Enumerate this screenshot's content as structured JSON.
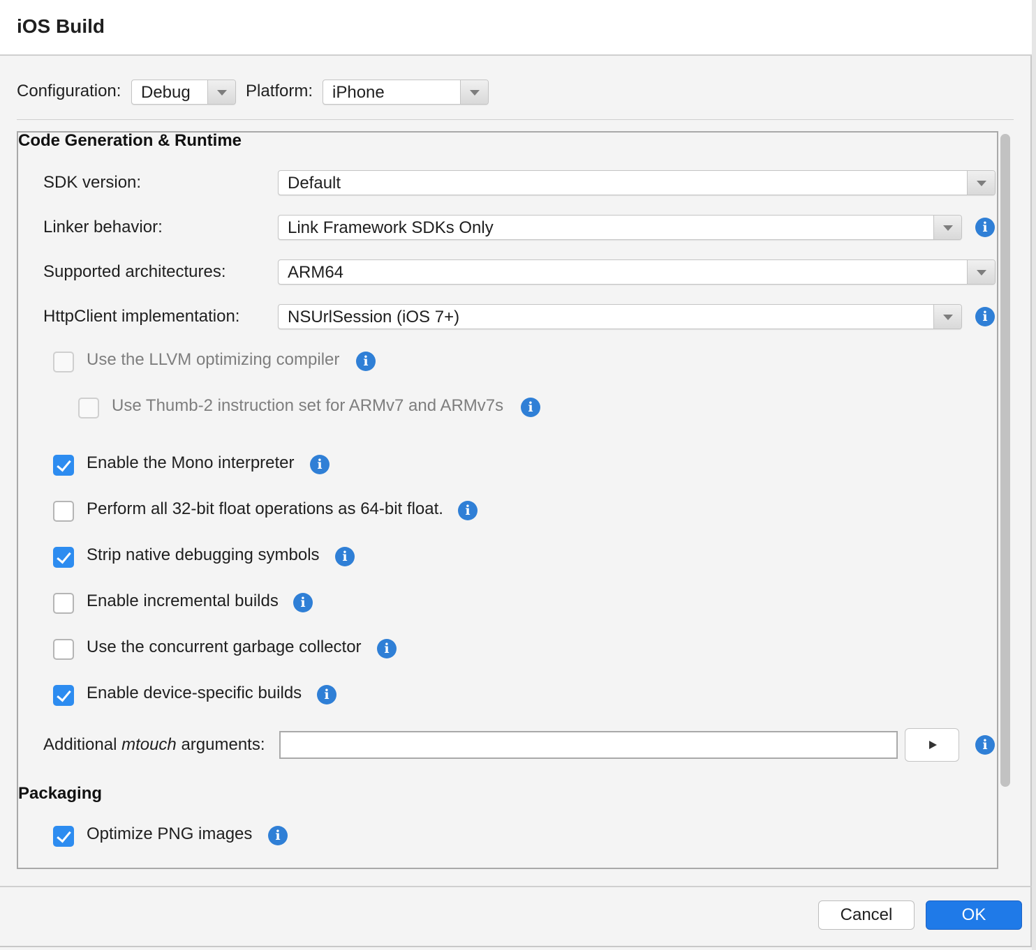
{
  "window": {
    "title": "iOS Build"
  },
  "config": {
    "configuration_label": "Configuration:",
    "configuration_value": "Debug",
    "platform_label": "Platform:",
    "platform_value": "iPhone"
  },
  "sections": {
    "codegen_title": "Code Generation & Runtime",
    "packaging_title": "Packaging"
  },
  "fields": {
    "sdk": {
      "label": "SDK version:",
      "value": "Default"
    },
    "linker": {
      "label": "Linker behavior:",
      "value": "Link Framework SDKs Only"
    },
    "arch": {
      "label": "Supported architectures:",
      "value": "ARM64"
    },
    "httpclient": {
      "label": "HttpClient implementation:",
      "value": "NSUrlSession (iOS 7+)"
    },
    "mtouch": {
      "label_prefix": "Additional ",
      "label_em": "mtouch",
      "label_suffix": " arguments:",
      "value": ""
    }
  },
  "options": {
    "llvm": {
      "label": "Use the LLVM optimizing compiler",
      "checked": false,
      "disabled": true
    },
    "thumb2": {
      "label": "Use Thumb-2 instruction set for ARMv7 and ARMv7s",
      "checked": false,
      "disabled": true
    },
    "mono_interp": {
      "label": "Enable the Mono interpreter",
      "checked": true,
      "disabled": false
    },
    "float64": {
      "label": "Perform all 32-bit float operations as 64-bit float.",
      "checked": false,
      "disabled": false
    },
    "strip_symbols": {
      "label": "Strip native debugging symbols",
      "checked": true,
      "disabled": false
    },
    "incremental": {
      "label": "Enable incremental builds",
      "checked": false,
      "disabled": false
    },
    "concurrent_gc": {
      "label": "Use the concurrent garbage collector",
      "checked": false,
      "disabled": false
    },
    "device_specific": {
      "label": "Enable device-specific builds",
      "checked": true,
      "disabled": false
    },
    "optimize_png": {
      "label": "Optimize PNG images",
      "checked": true,
      "disabled": false
    }
  },
  "icons": {
    "info": "i",
    "info_name": "info-icon"
  },
  "buttons": {
    "cancel": "Cancel",
    "ok": "OK"
  },
  "colors": {
    "accent": "#1f7ae8",
    "checkbox": "#2d8cf0",
    "info": "#2f7fd6"
  }
}
